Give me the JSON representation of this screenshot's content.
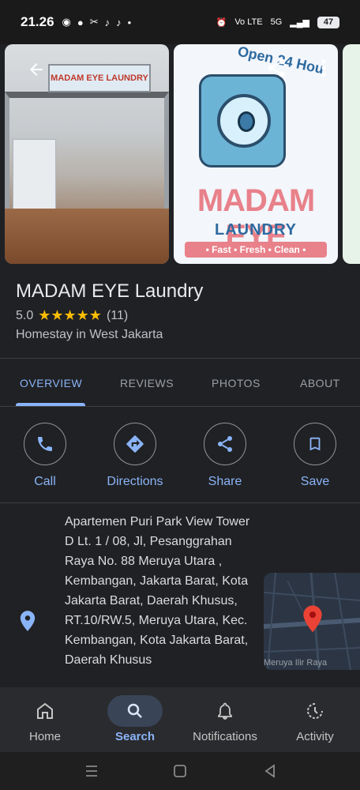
{
  "status_bar": {
    "time": "21.26",
    "network": "Vo LTE",
    "signal": "5G",
    "battery": "47"
  },
  "photos": {
    "photo1_sign": "MADAM EYE LAUNDRY",
    "photo2_open": "Open 24 Hou",
    "photo2_brand": "MADAM EYE",
    "photo2_sub": "LAUNDRY",
    "photo2_tag": "• Fast • Fresh • Clean •"
  },
  "place": {
    "name": "MADAM EYE Laundry",
    "rating": "5.0",
    "stars": "★★★★★",
    "review_count": "(11)",
    "category": "Homestay in West Jakarta"
  },
  "tabs": [
    {
      "label": "OVERVIEW"
    },
    {
      "label": "REVIEWS"
    },
    {
      "label": "PHOTOS"
    },
    {
      "label": "ABOUT"
    }
  ],
  "actions": {
    "call": "Call",
    "directions": "Directions",
    "share": "Share",
    "save": "Save"
  },
  "address": "Apartemen Puri Park View Tower D Lt. 1 / 08, Jl, Pesanggrahan Raya No. 88 Meruya Utara , Kembangan, Jakarta Barat, Kota Jakarta Barat, Daerah Khusus, RT.10/RW.5, Meruya Utara, Kec. Kembangan, Kota Jakarta Barat, Daerah Khusus",
  "map_label": "Meruya Ilir Raya",
  "bottom_nav": {
    "home": "Home",
    "search": "Search",
    "notifications": "Notifications",
    "activity": "Activity"
  },
  "colors": {
    "accent": "#8ab4f8",
    "star": "#fbbc04",
    "pin": "#ea4335"
  }
}
